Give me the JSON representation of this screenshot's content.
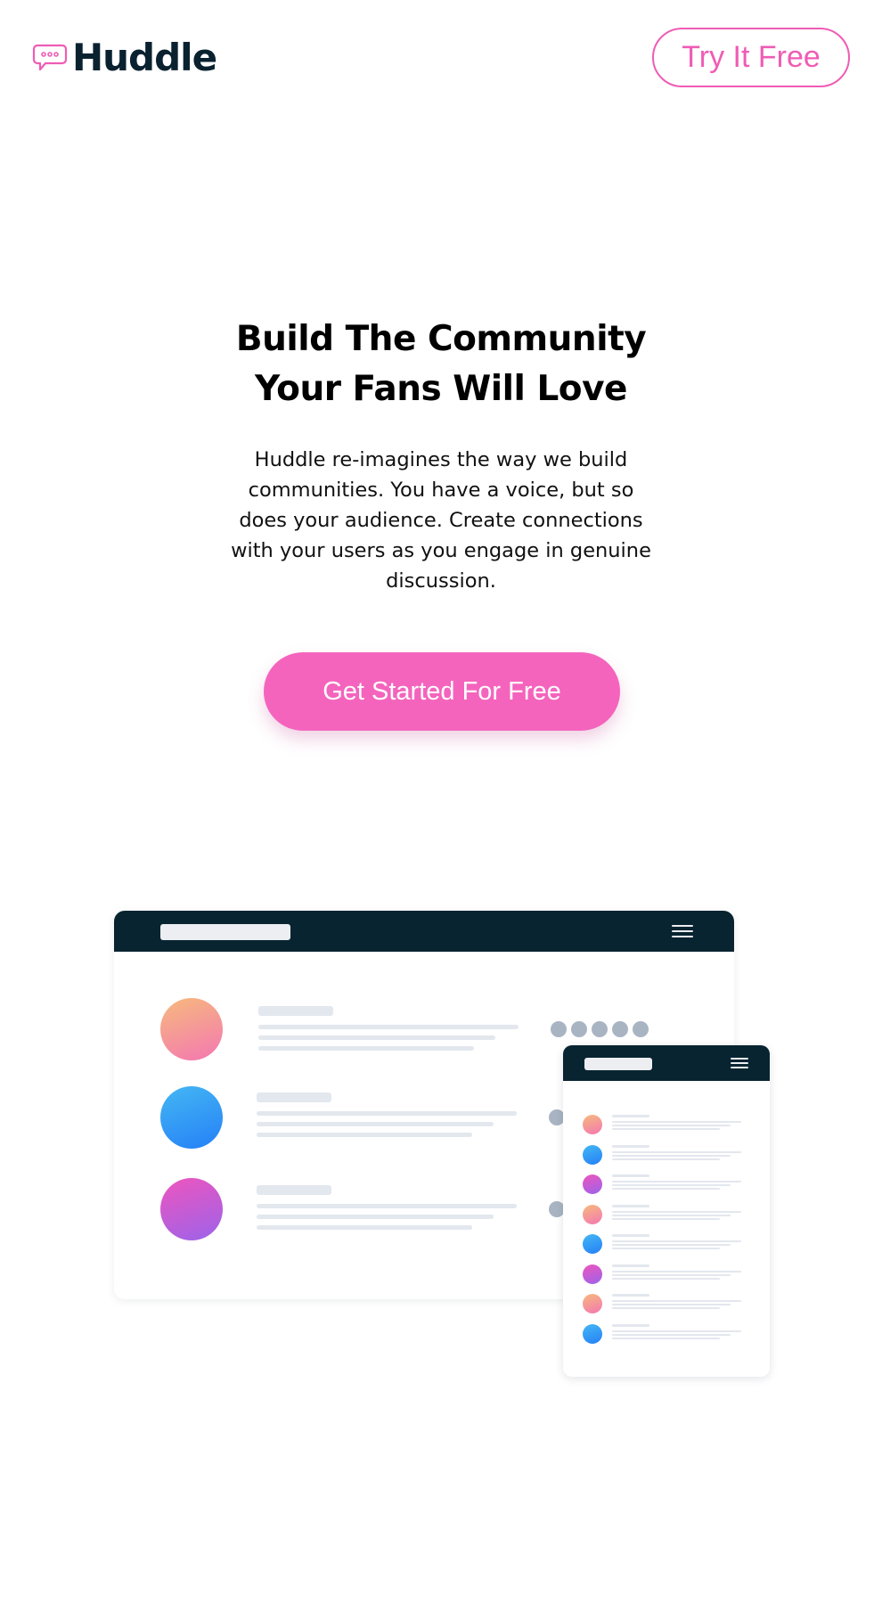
{
  "header": {
    "brand": "Huddle",
    "logo_icon": "chat-bubble-icon",
    "cta_label": "Try It Free"
  },
  "hero": {
    "title_line1": "Build The Community",
    "title_line2": "Your Fans Will Love",
    "description": "Huddle re-imagines the way we build communities. You have a voice, but so does your audience. Create connections with your users as you engage in genuine discussion.",
    "cta_label": "Get Started For Free"
  },
  "colors": {
    "brand_dark": "#082431",
    "accent_pink": "#f464bd",
    "avatar_gradients": [
      "orange-pink",
      "blue",
      "pink-purple"
    ]
  },
  "mockup": {
    "menu_icon": "hamburger-menu-icon",
    "desktop_rows": [
      "orange-pink",
      "blue",
      "pink-purple"
    ],
    "mobile_rows": [
      "orange-pink",
      "blue",
      "pink-purple",
      "orange-pink",
      "blue",
      "pink-purple",
      "orange-pink",
      "blue"
    ]
  }
}
